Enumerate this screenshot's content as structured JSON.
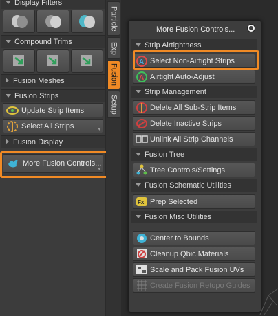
{
  "left_panel": {
    "display_filters": "Display Filters",
    "compound_trims": "Compound Trims",
    "fusion_meshes": "Fusion Meshes",
    "fusion_strips": "Fusion Strips",
    "update_strip_items": "Update Strip Items",
    "select_all_strips": "Select All Strips",
    "fusion_display": "Fusion Display",
    "more_fusion_controls": "More Fusion Controls..."
  },
  "tabs": {
    "particle": "Particle",
    "exp": "Exp",
    "fusion": "Fusion",
    "setup": "Setup"
  },
  "popup": {
    "title": "More Fusion Controls...",
    "sections": {
      "strip_airtightness": "Strip Airtightness",
      "strip_management": "Strip Management",
      "fusion_tree": "Fusion Tree",
      "fusion_schematic_utilities": "Fusion Schematic Utilities",
      "fusion_misc_utilities": "Fusion Misc Utilities"
    },
    "buttons": {
      "select_non_airtight": "Select Non-Airtight Strips",
      "airtight_auto_adjust": "Airtight Auto-Adjust",
      "delete_all_sub_strip": "Delete All Sub-Strip Items",
      "delete_inactive_strips": "Delete Inactive Strips",
      "unlink_all_strip_channels": "Unlink All Strip Channels",
      "tree_controls_settings": "Tree Controls/Settings",
      "prep_selected": "Prep Selected",
      "center_to_bounds": "Center to Bounds",
      "cleanup_qbic_materials": "Cleanup Qbic Materials",
      "scale_and_pack_fusion_uvs": "Scale and Pack Fusion UVs",
      "create_fusion_retopo_guides": "Create Fusion Retopo Guides"
    }
  },
  "colors": {
    "highlight": "#f08a25",
    "active_tab": "#f08a25",
    "panel_bg": "#3c3c3c"
  }
}
